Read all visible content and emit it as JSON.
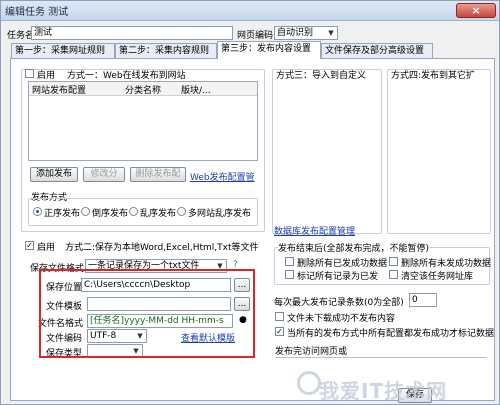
{
  "window": {
    "title": "编辑任务 测试",
    "close_symbol": "×"
  },
  "header": {
    "task_name_label": "任务名:",
    "task_name_value": "测试",
    "encoding_label": "网页编码",
    "encoding_value": "自动识别"
  },
  "tabs": [
    {
      "label": "第一步：采集网址规则"
    },
    {
      "label": "第二步：采集内容规则"
    },
    {
      "label": "第三步：发布内容设置"
    },
    {
      "label": "文件保存及部分高级设置"
    }
  ],
  "method1": {
    "enable_label": "启用",
    "title": "方式一：Web在线发布到网站",
    "columns": [
      "网站发布配置",
      "分类名称",
      "版块/..."
    ],
    "buttons": {
      "add": "添加发布",
      "modify": "修改分",
      "delete": "删除发布配"
    },
    "config_link": "Web发布配置管",
    "publish_method_label": "发布方式",
    "radios": [
      "正序发布",
      "倒序发布",
      "乱序发布",
      "多网站乱序发布"
    ]
  },
  "method3": {
    "title": "方式三：导入到自定义",
    "link": "数据库发布配置管理"
  },
  "method4": {
    "title": "方式四:发布到其它扩"
  },
  "method2": {
    "enable_label": "启用",
    "title": "方式二:保存为本地Word,Excel,Html,Txt等文件",
    "save_format_label": "保存文件格式",
    "save_format_value": "一条记录保存为一个txt文件",
    "save_location_label": "保存位置",
    "save_location_value": "C:\\Users\\ccccn\\Desktop",
    "template_label": "文件模板",
    "filename_format_label": "文件名格式",
    "filename_format_value": "[任务名]yyyy-MM-dd HH-mm-s",
    "file_encoding_label": "文件编码",
    "file_encoding_value": "UTF-8",
    "view_template_link": "查看默认模版",
    "save_type_label": "保存类型",
    "browse_label": "..."
  },
  "after_publish": {
    "title": "发布结束后(全部发布完成，不能暂停)",
    "options": [
      "删除所有已发成功数据",
      "删除所有未发成功数据",
      "标记所有记录为已发",
      "清空该任务网址库"
    ]
  },
  "settings": {
    "max_records_label": "每次最大发布记录条数(0为全部)",
    "max_records_value": "0",
    "skip_failed_label": "文件未下载成功不发布内容",
    "mark_success_label": "当所有的发布方式中所有配置都发布成功才标记数据",
    "visit_url_label": "发布完访问网页或"
  },
  "footer": {
    "save_label": "保存"
  },
  "watermark": {
    "text": "我爱IT技术网"
  },
  "colors": {
    "highlight_box": "#d8272a",
    "link": "#1c3fa8"
  }
}
